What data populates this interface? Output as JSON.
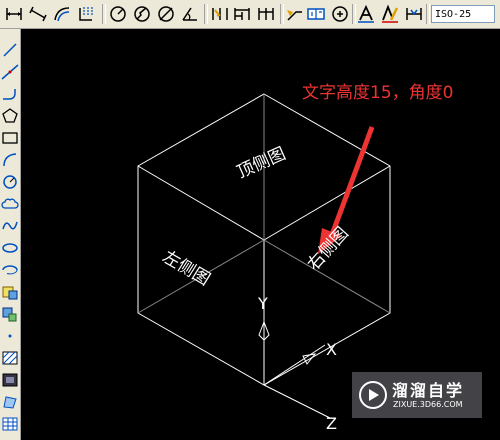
{
  "toolbar": {
    "icons": [
      "dim-linear-icon",
      "dim-aligned-icon",
      "dim-arc-length-icon",
      "dim-ordinate-icon",
      "dim-radius-icon",
      "dim-jogged-icon",
      "dim-diameter-icon",
      "dim-angular-icon",
      "quick-dim-icon",
      "dim-baseline-icon",
      "dim-continue-icon",
      "quick-leader-icon",
      "tolerance-icon",
      "center-mark-icon",
      "dim-edit-icon",
      "dim-text-edit-icon",
      "dim-update-icon"
    ],
    "dim_style_value": "ISO-25"
  },
  "left_toolbar": {
    "icons": [
      "line-icon",
      "construction-line-icon",
      "polyline-icon",
      "polygon-icon",
      "rectangle-icon",
      "arc-icon",
      "circle-icon",
      "revision-cloud-icon",
      "spline-icon",
      "ellipse-icon",
      "ellipse-arc-icon",
      "insert-block-icon",
      "make-block-icon",
      "point-icon",
      "hatch-icon",
      "gradient-icon",
      "region-icon",
      "table-icon"
    ]
  },
  "drawing": {
    "annotation_text": "文字高度15，角度0",
    "annotation_color": "#e33333",
    "face_labels": {
      "top": "顶侧图",
      "left": "左侧图",
      "right": "右侧图"
    },
    "axis_labels": {
      "y": "Y",
      "x": "X",
      "z": "Z"
    },
    "line_color": "#ffffff"
  },
  "watermark": {
    "title": "溜溜自学",
    "subtitle": "ZIXUE.3D66.COM"
  }
}
